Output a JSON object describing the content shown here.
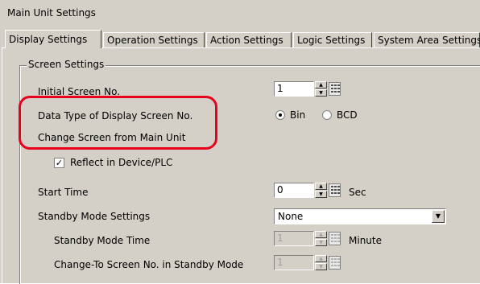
{
  "window": {
    "title": "Main Unit Settings"
  },
  "tabs": [
    {
      "label": "Display Settings",
      "active": true
    },
    {
      "label": "Operation Settings",
      "active": false
    },
    {
      "label": "Action Settings",
      "active": false
    },
    {
      "label": "Logic Settings",
      "active": false
    },
    {
      "label": "System Area Settings",
      "active": false
    }
  ],
  "screen_settings": {
    "legend": "Screen Settings",
    "initial_screen": {
      "label": "Initial Screen No.",
      "value": "1"
    },
    "data_type": {
      "label": "Data Type of Display Screen No.",
      "options": [
        "Bin",
        "BCD"
      ],
      "selected": "Bin"
    },
    "change_screen": {
      "label": "Change Screen from Main Unit"
    },
    "reflect": {
      "label": "Reflect in Device/PLC",
      "checked": true
    },
    "start_time": {
      "label": "Start Time",
      "value": "0",
      "unit": "Sec"
    },
    "standby_mode": {
      "label": "Standby Mode Settings",
      "value": "None"
    },
    "standby_time": {
      "label": "Standby Mode Time",
      "value": "1",
      "unit": "Minute",
      "enabled": false
    },
    "standby_screen": {
      "label": "Change-To Screen No. in Standby Mode",
      "value": "1",
      "enabled": false
    }
  },
  "colors": {
    "highlight": "#e8001c",
    "panel": "#d4d0c8"
  }
}
